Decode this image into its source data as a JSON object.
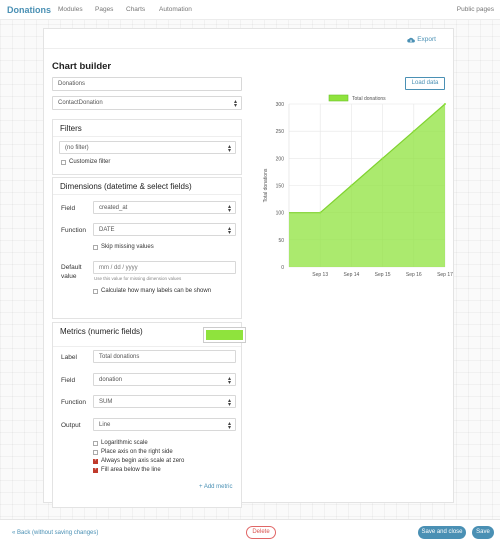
{
  "nav": {
    "brand": "Donations",
    "links": [
      "Modules",
      "Pages",
      "Charts",
      "Automation"
    ],
    "right": "Public pages"
  },
  "toolbar": {
    "export_label": "Export",
    "export_icon": "cloud-download-icon"
  },
  "builder": {
    "title": "Chart builder",
    "name_value": "Donations",
    "module_value": "ContactDonation",
    "load_label": "Load data"
  },
  "filters": {
    "title": "Filters",
    "filter_value": "(no filter)",
    "customize_label": "Customize filter"
  },
  "dimensions": {
    "title": "Dimensions (datetime & select fields)",
    "field_label": "Field",
    "field_value": "created_at",
    "function_label": "Function",
    "function_value": "DATE",
    "skip_label": "Skip missing values",
    "default_label": "Default value",
    "default_placeholder": "mm / dd / yyyy",
    "default_hint": "Use this value for missing dimension values",
    "calc_label": "Calculate how many labels can be shown"
  },
  "metrics": {
    "title": "Metrics (numeric fields)",
    "color": "#8fe33d",
    "label_label": "Label",
    "label_value": "Total donations",
    "field_label": "Field",
    "field_value": "donation",
    "function_label": "Function",
    "function_value": "SUM",
    "output_label": "Output",
    "output_value": "Line",
    "options": [
      {
        "label": "Logarithmic scale",
        "checked": false
      },
      {
        "label": "Place axis on the right side",
        "checked": false
      },
      {
        "label": "Always begin axis scale at zero",
        "checked": true
      },
      {
        "label": "Fill area below the line",
        "checked": true
      }
    ],
    "add_label": "+ Add metric"
  },
  "chart_data": {
    "type": "area",
    "categories": [
      "Sep 13",
      "Sep 14",
      "Sep 15",
      "Sep 16",
      "Sep 17"
    ],
    "series": [
      {
        "name": "Total donations",
        "values": [
          100,
          150,
          200,
          250,
          300
        ],
        "color": "#8fe33d"
      }
    ],
    "ylabel": "Total donations",
    "xlabel": "",
    "ylim": [
      0,
      300
    ],
    "yticks": [
      0,
      50,
      100,
      150,
      200,
      250,
      300
    ],
    "legend": "top",
    "grid": true
  },
  "footer": {
    "back_label": "« Back (without saving changes)",
    "delete_label": "Delete",
    "save_close_label": "Save and close",
    "save_label": "Save"
  }
}
